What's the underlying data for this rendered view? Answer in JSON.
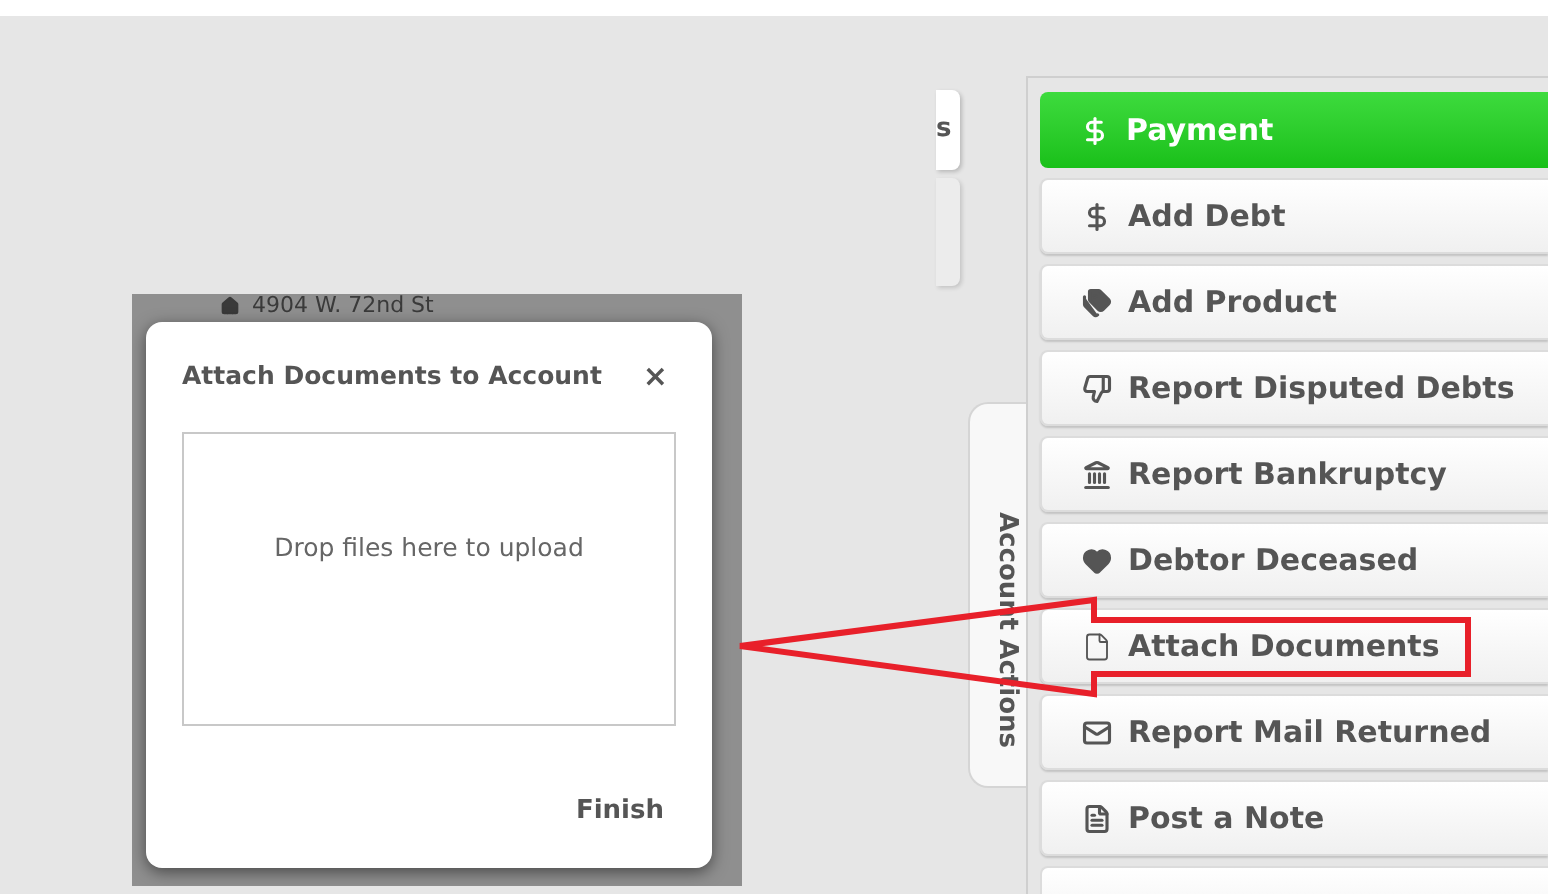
{
  "background": {
    "address": "4904 W. 72nd St"
  },
  "side_tab": {
    "label": "s"
  },
  "account_actions_tab": {
    "label": "Account Actions"
  },
  "actions": [
    {
      "label": "Payment",
      "selected": true
    },
    {
      "label": "Add Debt",
      "selected": false
    },
    {
      "label": "Add Product",
      "selected": false
    },
    {
      "label": "Report Disputed Debts",
      "selected": false
    },
    {
      "label": "Report Bankruptcy",
      "selected": false
    },
    {
      "label": "Debtor Deceased",
      "selected": false
    },
    {
      "label": "Attach Documents",
      "selected": false
    },
    {
      "label": "Report Mail Returned",
      "selected": false
    },
    {
      "label": "Post a Note",
      "selected": false
    }
  ],
  "dialog": {
    "title": "Attach Documents to Account",
    "close": "×",
    "dropzone": "Drop files here to upload",
    "finish": "Finish"
  }
}
